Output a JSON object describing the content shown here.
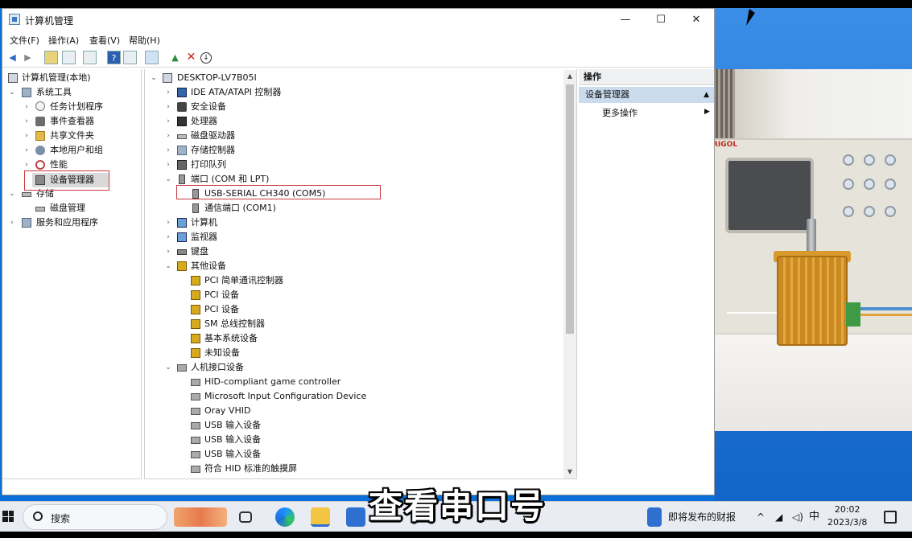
{
  "window": {
    "title": "计算机管理",
    "controls": {
      "minimize": "—",
      "maximize": "☐",
      "close": "✕"
    }
  },
  "menu": [
    "文件(F)",
    "操作(A)",
    "查看(V)",
    "帮助(H)"
  ],
  "left_tree": {
    "root": "计算机管理(本地)",
    "system_tools": "系统工具",
    "task_scheduler": "任务计划程序",
    "event_viewer": "事件查看器",
    "shared_folders": "共享文件夹",
    "local_users": "本地用户和组",
    "performance": "性能",
    "device_manager": "设备管理器",
    "storage": "存储",
    "disk_management": "磁盘管理",
    "services_apps": "服务和应用程序"
  },
  "device_tree": {
    "computer": "DESKTOP-LV7B05I",
    "ide": "IDE ATA/ATAPI 控制器",
    "security": "安全设备",
    "processor": "处理器",
    "disk_drives": "磁盘驱动器",
    "storage_controllers": "存储控制器",
    "print_queue": "打印队列",
    "ports": "端口 (COM 和 LPT)",
    "usb_serial": "USB-SERIAL CH340 (COM5)",
    "comm_port": "通信端口 (COM1)",
    "computer_cat": "计算机",
    "monitors": "监视器",
    "keyboards": "键盘",
    "other_devices": "其他设备",
    "other_items": [
      "PCI 简单通讯控制器",
      "PCI 设备",
      "PCI 设备",
      "SM 总线控制器",
      "基本系统设备",
      "未知设备"
    ],
    "hid": "人机接口设备",
    "hid_items": [
      "HID-compliant game controller",
      "Microsoft Input Configuration Device",
      "Oray VHID",
      "USB 输入设备",
      "USB 输入设备",
      "USB 输入设备",
      "符合 HID 标准的触摸屏"
    ]
  },
  "actions": {
    "header": "操作",
    "section": "设备管理器",
    "more": "更多操作"
  },
  "taskbar": {
    "search_placeholder": "搜索",
    "news": "即将发布的财报",
    "ime": "中",
    "time": "20:02",
    "date": "2023/3/8"
  },
  "photo": {
    "brand": "RIGOL"
  },
  "caption": "查看串口号",
  "colors": {
    "desktop": "#0a6fd8",
    "highlight_box": "#c9393b",
    "action_section": "#c9dbed"
  }
}
